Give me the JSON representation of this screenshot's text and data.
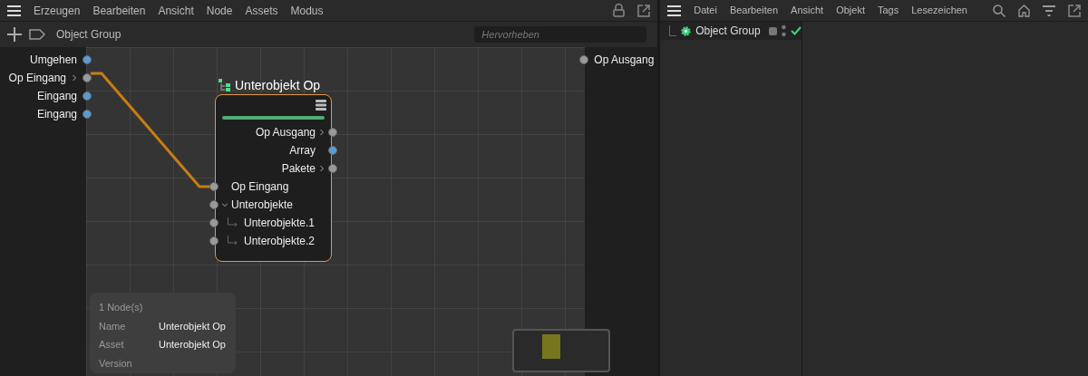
{
  "node_editor": {
    "menu": [
      "Erzeugen",
      "Bearbeiten",
      "Ansicht",
      "Node",
      "Assets",
      "Modus"
    ],
    "breadcrumb": "Object Group",
    "search": {
      "placeholder": "Hervorheben"
    },
    "inputs": [
      {
        "label": "Umgehen",
        "color": "#5b9bd5",
        "expandable": false
      },
      {
        "label": "Op Eingang",
        "color": "#9a9a9a",
        "expandable": true
      },
      {
        "label": "Eingang",
        "color": "#5b9bd5",
        "expandable": false
      },
      {
        "label": "Eingang",
        "color": "#5b9bd5",
        "expandable": false
      }
    ],
    "outputs": [
      {
        "label": "Op Ausgang",
        "color": "#9a9a9a"
      }
    ],
    "node": {
      "title": "Unterobjekt Op",
      "selected": true,
      "outputs": [
        {
          "label": "Op Ausgang",
          "color": "#9a9a9a",
          "expandable": true
        },
        {
          "label": "Array",
          "color": "#5b9bd5",
          "expandable": false
        },
        {
          "label": "Pakete",
          "color": "#9a9a9a",
          "expandable": true
        }
      ],
      "inputs": [
        {
          "label": "Op Eingang",
          "color": "#9a9a9a"
        },
        {
          "label": "Unterobjekte",
          "color": "#9a9a9a",
          "expanded": true,
          "children": [
            {
              "label": "Unterobjekte.1",
              "color": "#9a9a9a"
            },
            {
              "label": "Unterobjekte.2",
              "color": "#9a9a9a"
            }
          ]
        }
      ]
    },
    "info": {
      "count": "1 Node(s)",
      "rows": [
        {
          "label": "Name",
          "value": "Unterobjekt Op"
        },
        {
          "label": "Asset",
          "value": "Unterobjekt Op"
        },
        {
          "label": "Version"
        }
      ]
    }
  },
  "object_manager": {
    "menu": [
      "Datei",
      "Bearbeiten",
      "Ansicht",
      "Objekt",
      "Tags",
      "Lesezeichen"
    ],
    "objects": [
      {
        "name": "Object Group",
        "enabled": true
      }
    ]
  }
}
